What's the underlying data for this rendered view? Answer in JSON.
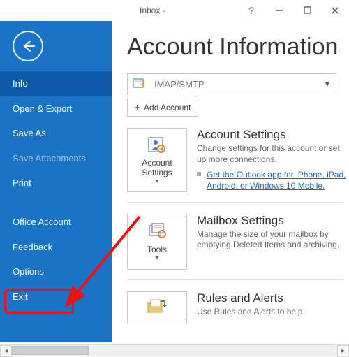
{
  "titlebar": {
    "title": "Inbox -"
  },
  "sidebar": {
    "items": [
      {
        "label": "Info"
      },
      {
        "label": "Open & Export"
      },
      {
        "label": "Save As"
      },
      {
        "label": "Save Attachments"
      },
      {
        "label": "Print"
      },
      {
        "label": "Office Account"
      },
      {
        "label": "Feedback"
      },
      {
        "label": "Options"
      },
      {
        "label": "Exit"
      }
    ]
  },
  "main": {
    "title": "Account Information",
    "account_type": "IMAP/SMTP",
    "add_account": "Add Account",
    "sections": {
      "account": {
        "button": "Account Settings",
        "heading": "Account Settings",
        "desc": "Change settings for this account or set up more connections.",
        "link": "Get the Outlook app for iPhone, iPad, Android, or Windows 10 Mobile."
      },
      "mailbox": {
        "button": "Tools",
        "heading": "Mailbox Settings",
        "desc": "Manage the size of your mailbox by emptying Deleted Items and archiving."
      },
      "rules": {
        "heading": "Rules and Alerts",
        "desc": "Use Rules and Alerts to help"
      }
    }
  }
}
